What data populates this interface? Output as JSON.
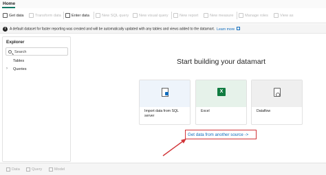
{
  "tab": {
    "label": "Home"
  },
  "ribbon": {
    "get_data": "Get data",
    "transform_data": "Transform data",
    "enter_data": "Enter data",
    "new_sql_query": "New SQL query",
    "new_visual_query": "New visual query",
    "new_report": "New report",
    "new_measure": "New measure",
    "manage_roles": "Manage roles",
    "view_as": "View as"
  },
  "info_bar": {
    "message": "A default dataset for faster reporting was created and will be automatically updated with any tables and views added to the datamart.",
    "link": "Learn more"
  },
  "explorer": {
    "title": "Explorer",
    "search_placeholder": "Search",
    "items": [
      {
        "label": "Tables"
      },
      {
        "label": "Queries"
      }
    ]
  },
  "main": {
    "title": "Start building your datamart",
    "cards": [
      {
        "label": "Import data from SQL server",
        "icon": "sql-server-icon",
        "bg": "#eef4fb"
      },
      {
        "label": "Excel",
        "icon": "excel-icon",
        "bg": "#e6f2ea"
      },
      {
        "label": "Dataflow",
        "icon": "dataflow-icon",
        "bg": "#efefef"
      }
    ],
    "get_data_link": "Get data from another source ->"
  },
  "bottom_bar": {
    "data": "Data",
    "query": "Query",
    "model": "Model"
  },
  "colors": {
    "accent": "#117865",
    "link": "#0f6cbd",
    "highlight": "#d13438"
  }
}
